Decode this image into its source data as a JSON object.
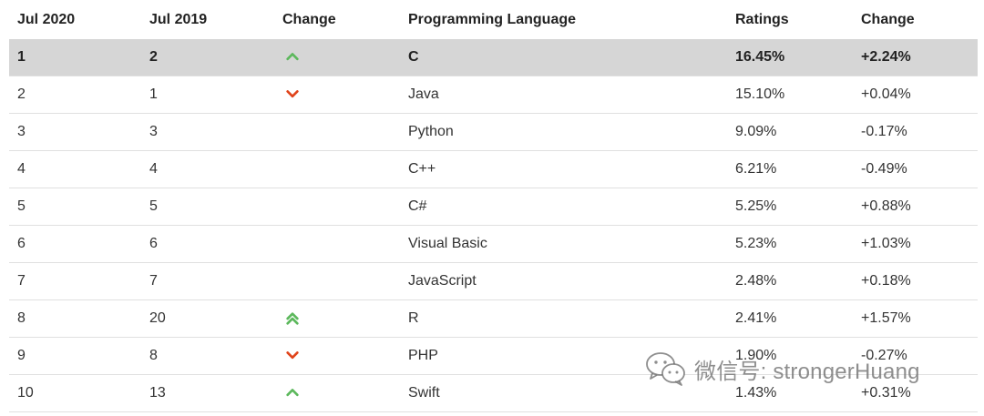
{
  "table": {
    "headers": [
      "Jul 2020",
      "Jul 2019",
      "Change",
      "Programming Language",
      "Ratings",
      "Change"
    ],
    "rows": [
      {
        "jul2020": "1",
        "jul2019": "2",
        "trend": "up",
        "language": "C",
        "rating": "16.45%",
        "change": "+2.24%"
      },
      {
        "jul2020": "2",
        "jul2019": "1",
        "trend": "down",
        "language": "Java",
        "rating": "15.10%",
        "change": "+0.04%"
      },
      {
        "jul2020": "3",
        "jul2019": "3",
        "trend": "none",
        "language": "Python",
        "rating": "9.09%",
        "change": "-0.17%"
      },
      {
        "jul2020": "4",
        "jul2019": "4",
        "trend": "none",
        "language": "C++",
        "rating": "6.21%",
        "change": "-0.49%"
      },
      {
        "jul2020": "5",
        "jul2019": "5",
        "trend": "none",
        "language": "C#",
        "rating": "5.25%",
        "change": "+0.88%"
      },
      {
        "jul2020": "6",
        "jul2019": "6",
        "trend": "none",
        "language": "Visual Basic",
        "rating": "5.23%",
        "change": "+1.03%"
      },
      {
        "jul2020": "7",
        "jul2019": "7",
        "trend": "none",
        "language": "JavaScript",
        "rating": "2.48%",
        "change": "+0.18%"
      },
      {
        "jul2020": "8",
        "jul2019": "20",
        "trend": "double-up",
        "language": "R",
        "rating": "2.41%",
        "change": "+1.57%"
      },
      {
        "jul2020": "9",
        "jul2019": "8",
        "trend": "down",
        "language": "PHP",
        "rating": "1.90%",
        "change": "-0.27%"
      },
      {
        "jul2020": "10",
        "jul2019": "13",
        "trend": "up",
        "language": "Swift",
        "rating": "1.43%",
        "change": "+0.31%"
      }
    ],
    "highlighted_row": 0
  },
  "icons": {
    "up": "chevron-up-icon",
    "down": "chevron-down-icon",
    "double-up": "double-chevron-up-icon"
  },
  "colors": {
    "up": "#5cb85c",
    "down": "#e0441b",
    "highlight_bg": "#d6d6d6"
  },
  "watermark": {
    "text": "微信号: strongerHuang",
    "icon": "wechat-icon"
  }
}
